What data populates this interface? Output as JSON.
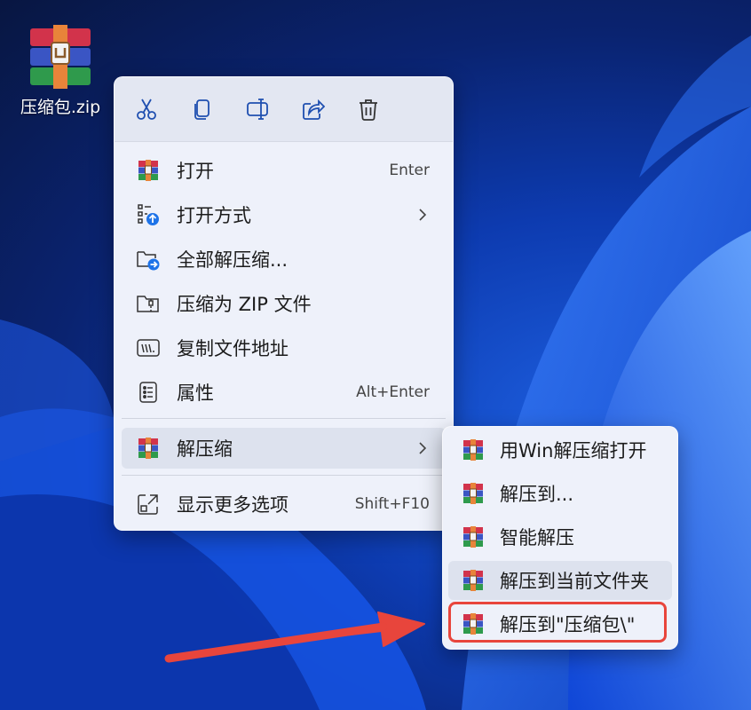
{
  "desktop": {
    "icon_label": "压缩包.zip",
    "icon": "winrar-archive-icon"
  },
  "menu": {
    "toolbar": [
      {
        "name": "cut-icon"
      },
      {
        "name": "copy-icon"
      },
      {
        "name": "rename-icon"
      },
      {
        "name": "share-icon"
      },
      {
        "name": "delete-icon"
      }
    ],
    "items": [
      {
        "label": "打开",
        "shortcut": "Enter",
        "icon": "winrar-icon"
      },
      {
        "label": "打开方式",
        "shortcut": "",
        "icon": "open-with-icon",
        "submenu": true
      },
      {
        "label": "全部解压缩...",
        "shortcut": "",
        "icon": "extract-all-icon"
      },
      {
        "label": "压缩为 ZIP 文件",
        "shortcut": "",
        "icon": "zip-folder-icon"
      },
      {
        "label": "复制文件地址",
        "shortcut": "",
        "icon": "copy-path-icon"
      },
      {
        "label": "属性",
        "shortcut": "Alt+Enter",
        "icon": "properties-icon"
      },
      {
        "label": "解压缩",
        "shortcut": "",
        "icon": "winrar-icon",
        "submenu": true
      },
      {
        "label": "显示更多选项",
        "shortcut": "Shift+F10",
        "icon": "more-options-icon"
      }
    ]
  },
  "submenu": {
    "items": [
      {
        "label": "用Win解压缩打开"
      },
      {
        "label": "解压到..."
      },
      {
        "label": "智能解压"
      },
      {
        "label": "解压到当前文件夹"
      },
      {
        "label": "解压到\"压缩包\\\""
      }
    ]
  },
  "colors": {
    "highlight": "#e8453c",
    "arrow": "#e8453c"
  }
}
